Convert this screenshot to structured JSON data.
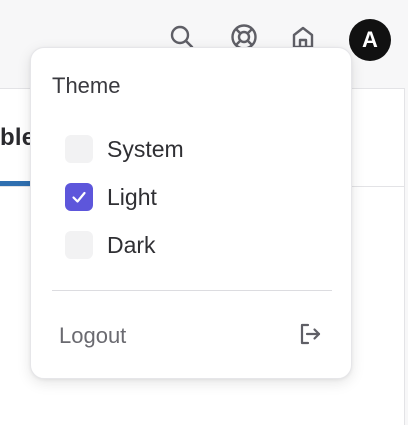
{
  "toolbar": {
    "avatar_initial": "A",
    "icons": [
      "search-icon",
      "help-lifebuoy-icon",
      "home-icon"
    ]
  },
  "background": {
    "tab_partial_label": "ble",
    "accent_color": "#2f6fb0"
  },
  "menu": {
    "heading": "Theme",
    "options": [
      {
        "label": "System",
        "checked": false
      },
      {
        "label": "Light",
        "checked": true
      },
      {
        "label": "Dark",
        "checked": false
      }
    ],
    "checked_color": "#5d56db",
    "logout_label": "Logout",
    "logout_icon": "logout-icon"
  }
}
